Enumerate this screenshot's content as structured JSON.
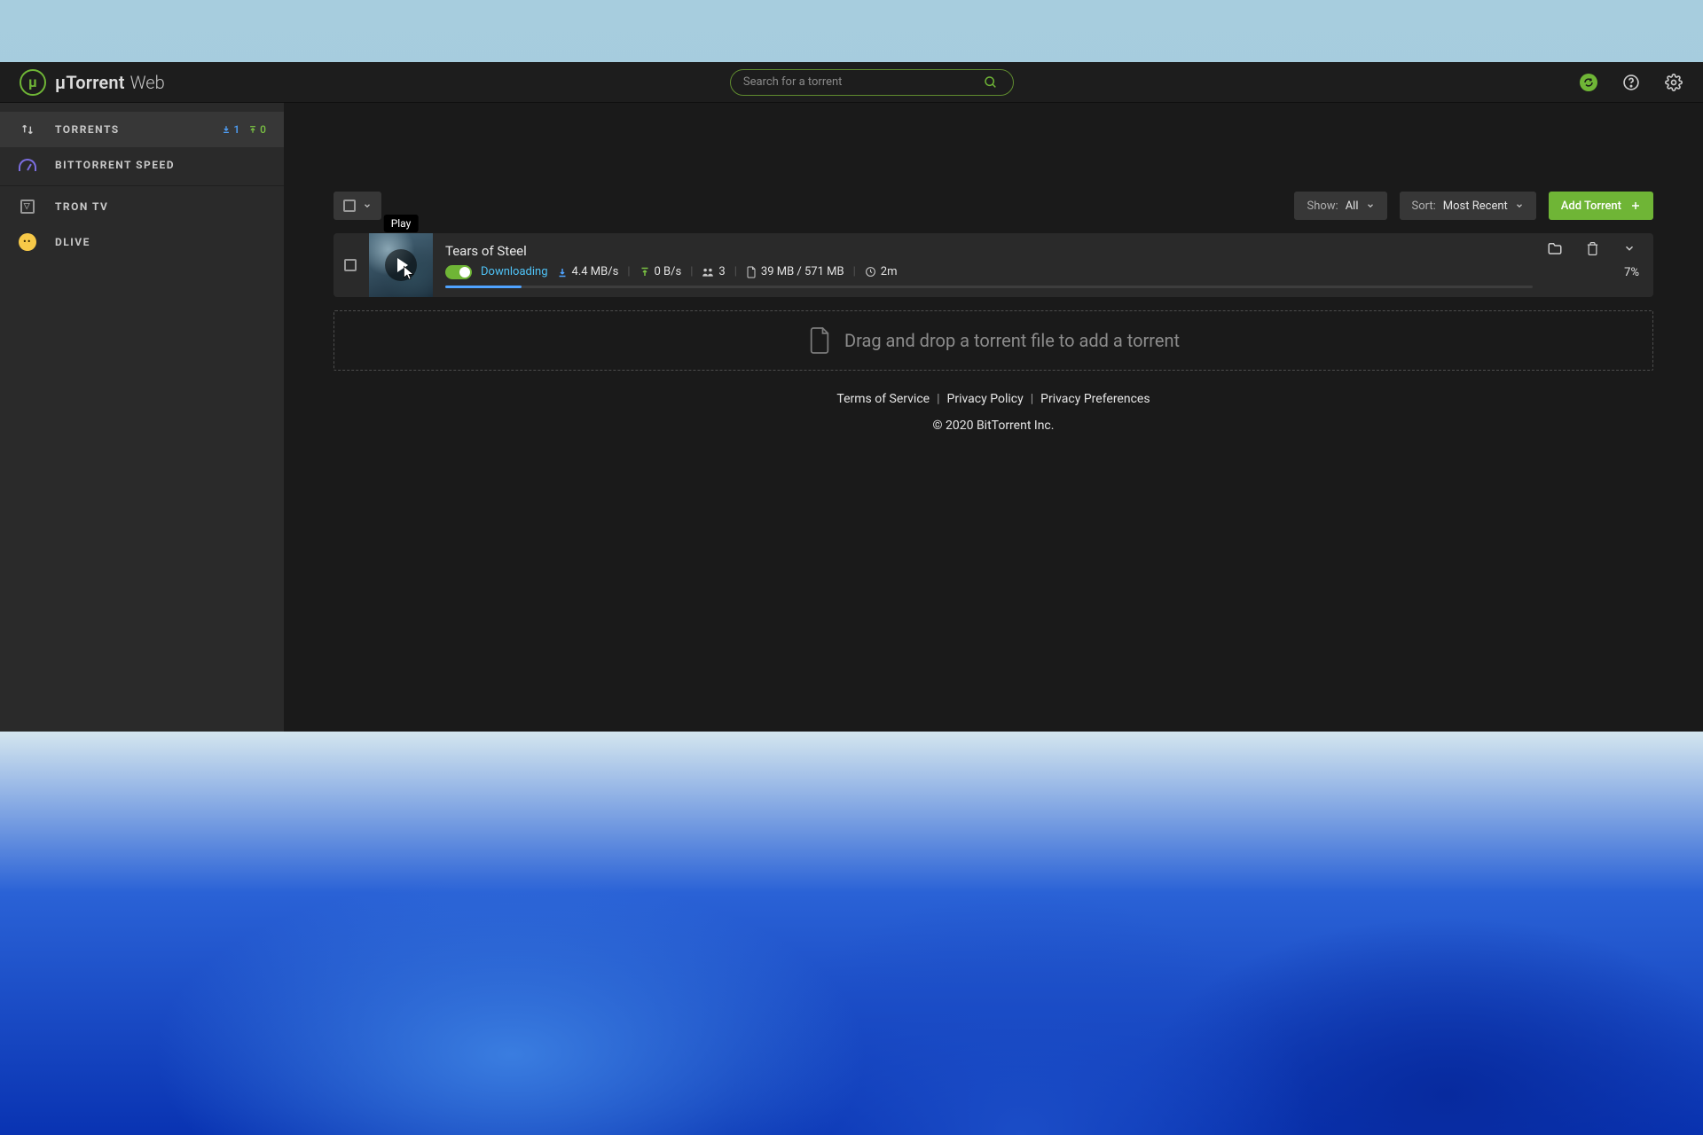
{
  "brand": {
    "name": "µTorrent",
    "sub": "Web",
    "logo_letter": "µ"
  },
  "search": {
    "placeholder": "Search for a torrent"
  },
  "sidebar": {
    "items": [
      {
        "label": "TORRENTS",
        "dl_count": "1",
        "up_count": "0"
      },
      {
        "label": "BITTORRENT SPEED"
      },
      {
        "label": "TRON TV",
        "tron_letter": "▽"
      },
      {
        "label": "DLIVE",
        "dlive_glyph": "••"
      }
    ]
  },
  "toolbar": {
    "show_label": "Show:",
    "show_value": "All",
    "sort_label": "Sort:",
    "sort_value": "Most Recent",
    "add_label": "Add Torrent"
  },
  "torrent": {
    "title": "Tears of Steel",
    "play_tooltip": "Play",
    "status": "Downloading",
    "dl_speed": "4.4 MB/s",
    "up_speed": "0 B/s",
    "peers": "3",
    "size": "39 MB / 571 MB",
    "eta": "2m",
    "percent": "7%",
    "progress_pct": 7
  },
  "dropzone": {
    "text": "Drag and drop a torrent file to add a torrent"
  },
  "footer": {
    "links": [
      "Terms of Service",
      "Privacy Policy",
      "Privacy Preferences"
    ],
    "copyright": "© 2020 BitTorrent Inc."
  }
}
